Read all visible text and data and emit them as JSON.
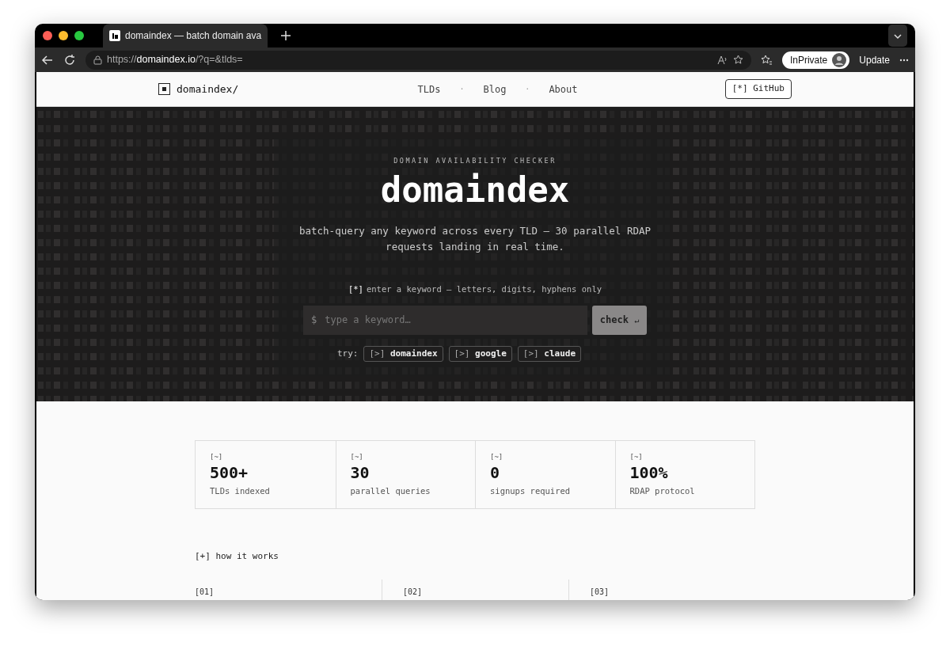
{
  "browser": {
    "tab_title": "domaindex — batch domain ava",
    "url": {
      "scheme": "https://",
      "host": "domaindex.io",
      "path": "/?q=&tlds="
    },
    "profile": "InPrivate",
    "update": "Update"
  },
  "nav": {
    "logo": "domaindex/",
    "links": [
      {
        "label": "TLDs"
      },
      {
        "label": "Blog"
      },
      {
        "label": "About"
      }
    ],
    "separator": "·",
    "github": "[*] GitHub"
  },
  "hero": {
    "eyebrow": "DOMAIN AVAILABILITY CHECKER",
    "title": "domaindex",
    "subtitle": "batch-query any keyword across every TLD — 30 parallel RDAP requests landing in real time.",
    "hint_mark": "[*]",
    "hint": "enter a keyword — letters, digits, hyphens only",
    "input": {
      "prompt": "$",
      "placeholder": "type a keyword…"
    },
    "check": {
      "label": "check",
      "icon": "↵"
    },
    "try_label": "try:",
    "suggestions": [
      {
        "mark": "[>]",
        "word": "domaindex"
      },
      {
        "mark": "[>]",
        "word": "google"
      },
      {
        "mark": "[>]",
        "word": "claude"
      }
    ]
  },
  "stats": [
    {
      "mark": "[~]",
      "value": "500+",
      "label": "TLDs indexed"
    },
    {
      "mark": "[~]",
      "value": "30",
      "label": "parallel queries"
    },
    {
      "mark": "[~]",
      "value": "0",
      "label": "signups required"
    },
    {
      "mark": "[~]",
      "value": "100%",
      "label": "RDAP protocol"
    }
  ],
  "how": {
    "title": "[+] how it works",
    "steps": [
      "[01]",
      "[02]",
      "[03]"
    ]
  }
}
